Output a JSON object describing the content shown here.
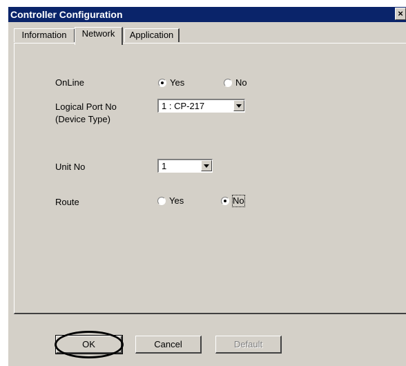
{
  "window": {
    "title": "Controller Configuration",
    "close_glyph": "×"
  },
  "tabs": [
    {
      "label": "Information"
    },
    {
      "label": "Network"
    },
    {
      "label": "Application"
    }
  ],
  "network": {
    "online": {
      "label": "OnLine",
      "yes": "Yes",
      "no": "No",
      "selected": "Yes"
    },
    "logical_port": {
      "label": "Logical Port No",
      "sublabel": "(Device Type)",
      "value": "1 : CP-217"
    },
    "unit_no": {
      "label": "Unit No",
      "value": "1"
    },
    "route": {
      "label": "Route",
      "yes": "Yes",
      "no": "No",
      "selected": "No"
    }
  },
  "buttons": {
    "ok": "OK",
    "cancel": "Cancel",
    "default": "Default"
  },
  "colors": {
    "titlebar": "#0a246a",
    "face": "#d4d0c8",
    "annotation": "#000000"
  }
}
